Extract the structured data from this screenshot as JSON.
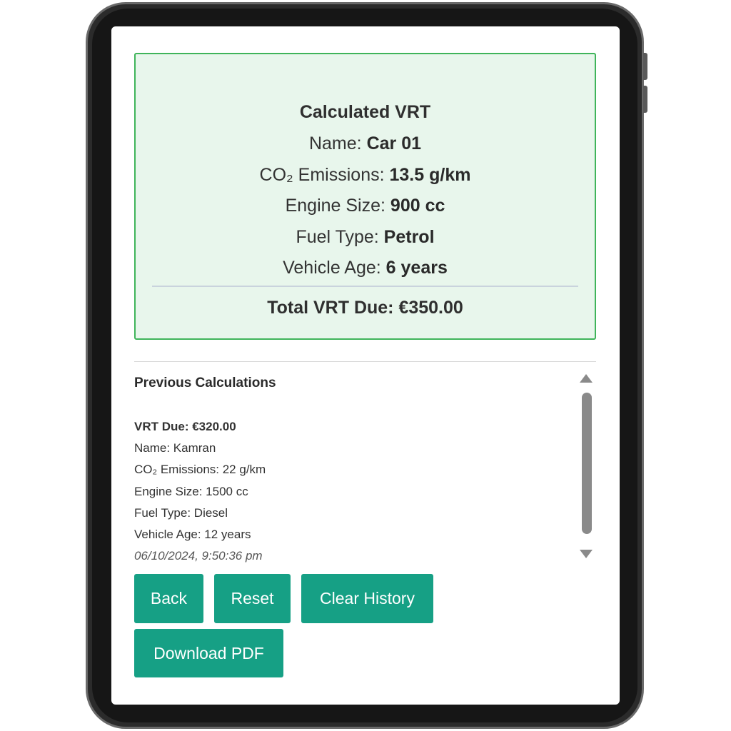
{
  "result": {
    "title": "Calculated VRT",
    "name_label": "Name: ",
    "name_value": "Car 01",
    "co2_label": "CO₂ Emissions: ",
    "co2_value": "13.5 g/km",
    "engine_label": "Engine Size: ",
    "engine_value": "900 cc",
    "fuel_label": "Fuel Type: ",
    "fuel_value": "Petrol",
    "age_label": "Vehicle Age: ",
    "age_value": "6 years",
    "total": "Total VRT Due: €350.00"
  },
  "history": {
    "title": "Previous Calculations",
    "entry": {
      "due": "VRT Due: €320.00",
      "name": "Name: Kamran",
      "co2": "CO₂ Emissions: 22 g/km",
      "engine": "Engine Size: 1500 cc",
      "fuel": "Fuel Type: Diesel",
      "age": "Vehicle Age: 12 years",
      "timestamp": "06/10/2024, 9:50:36 pm"
    }
  },
  "buttons": {
    "back": "Back",
    "reset": "Reset",
    "clear_history": "Clear History",
    "download_pdf": "Download PDF"
  },
  "colors": {
    "accent": "#16a085",
    "card_background": "#e8f6ec",
    "card_border": "#3fb45a"
  },
  "icons": {
    "scroll_up": "triangle-up-icon",
    "scroll_down": "triangle-down-icon"
  }
}
